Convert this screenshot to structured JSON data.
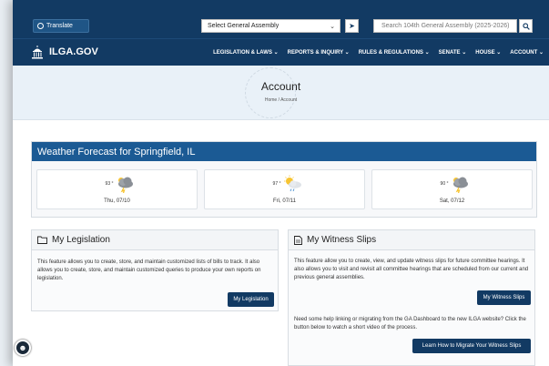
{
  "topbar": {
    "translate_label": "Translate",
    "assembly_select_value": "Select General Assembly",
    "search_placeholder": "Search 104th General Assembly (2025-2026)"
  },
  "nav": {
    "logo_text": "ILGA.GOV",
    "links": [
      "LEGISLATION & LAWS",
      "REPORTS & INQUIRY",
      "RULES & REGULATIONS",
      "SENATE",
      "HOUSE",
      "ACCOUNT"
    ]
  },
  "header": {
    "title": "Account",
    "breadcrumb_home": "Home",
    "breadcrumb_sep": "/",
    "breadcrumb_current": "Account"
  },
  "weather": {
    "title": "Weather Forecast for Springfield, IL",
    "days": [
      {
        "temp": "93 °",
        "date": "Thu, 07/10",
        "icon": "storm-cloud-icon"
      },
      {
        "temp": "97 °",
        "date": "Fri, 07/11",
        "icon": "sun-rain-cloud-icon"
      },
      {
        "temp": "90 °",
        "date": "Sat, 07/12",
        "icon": "storm-cloud-icon"
      }
    ]
  },
  "legislation": {
    "title": "My Legislation",
    "text": "This feature allows you to create, store, and maintain customized lists of bills to track. It also allows you to create, store, and maintain customized queries to produce your own reports on legislation.",
    "button": "My Legislation"
  },
  "witness": {
    "title": "My Witness Slips",
    "text": "This feature allow you to create, view, and update witness slips for future committee hearings. It also allows you to visit and revisit all committee hearings that are scheduled from our current and previous general assemblies.",
    "button": "My Witness Slips",
    "help_text": "Need some help linking or migrating from the GA Dashboard to the new ILGA website? Click the button below to watch a short video of the process.",
    "help_button": "Learn How to Migrate Your Witness Slips"
  },
  "colors": {
    "navy": "#123a63",
    "weather_header": "#1b5a94",
    "header_bg": "#e9f1f8"
  }
}
